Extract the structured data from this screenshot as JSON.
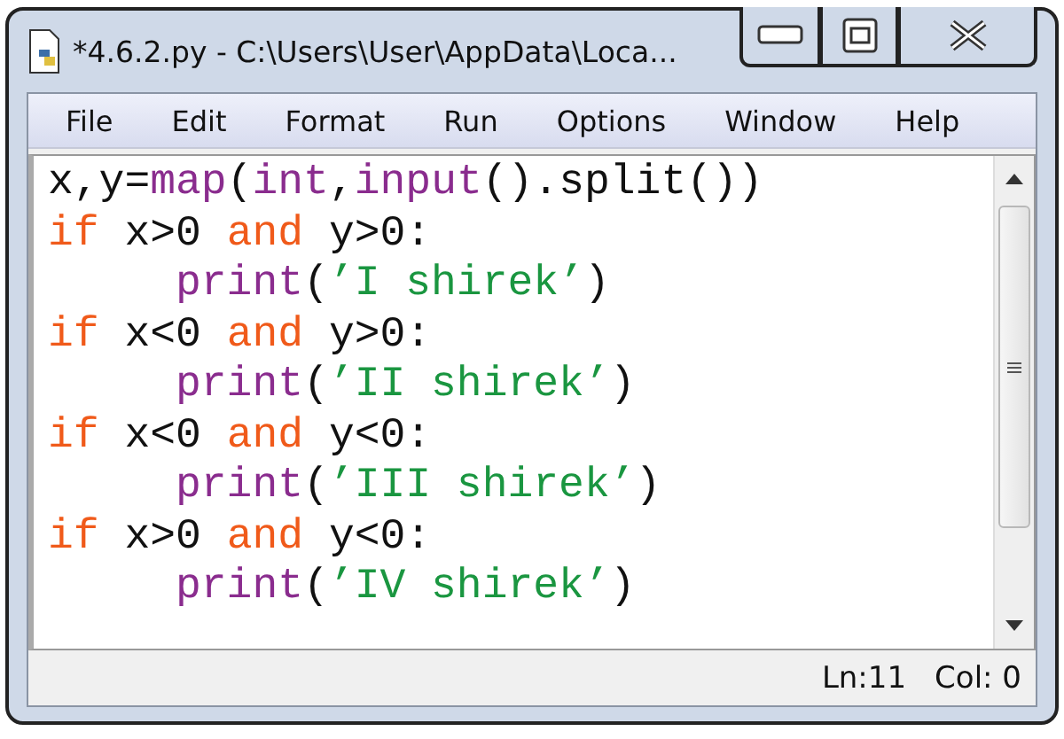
{
  "window": {
    "title": "*4.6.2.py - C:\\Users\\User\\AppData\\Loca..."
  },
  "menu": [
    "File",
    "Edit",
    "Format",
    "Run",
    "Options",
    "Window",
    "Help"
  ],
  "code": [
    {
      "tokens": [
        {
          "kind": "plain",
          "text": "x,y="
        },
        {
          "kind": "builtin",
          "text": "map"
        },
        {
          "kind": "plain",
          "text": "("
        },
        {
          "kind": "builtin",
          "text": "int"
        },
        {
          "kind": "plain",
          "text": ","
        },
        {
          "kind": "builtin",
          "text": "input"
        },
        {
          "kind": "plain",
          "text": "().split())"
        }
      ]
    },
    {
      "tokens": [
        {
          "kind": "keyword",
          "text": "if"
        },
        {
          "kind": "plain",
          "text": " x>0 "
        },
        {
          "kind": "keyword",
          "text": "and"
        },
        {
          "kind": "plain",
          "text": " y>0:"
        }
      ]
    },
    {
      "indented": true,
      "tokens": [
        {
          "kind": "builtin",
          "text": "print"
        },
        {
          "kind": "plain",
          "text": "("
        },
        {
          "kind": "string",
          "text": "’I shirek’"
        },
        {
          "kind": "plain",
          "text": ")"
        }
      ]
    },
    {
      "tokens": [
        {
          "kind": "keyword",
          "text": "if"
        },
        {
          "kind": "plain",
          "text": " x<0 "
        },
        {
          "kind": "keyword",
          "text": "and"
        },
        {
          "kind": "plain",
          "text": " y>0:"
        }
      ]
    },
    {
      "indented": true,
      "tokens": [
        {
          "kind": "builtin",
          "text": "print"
        },
        {
          "kind": "plain",
          "text": "("
        },
        {
          "kind": "string",
          "text": "’II shirek’"
        },
        {
          "kind": "plain",
          "text": ")"
        }
      ]
    },
    {
      "tokens": [
        {
          "kind": "keyword",
          "text": "if"
        },
        {
          "kind": "plain",
          "text": " x<0 "
        },
        {
          "kind": "keyword",
          "text": "and"
        },
        {
          "kind": "plain",
          "text": " y<0:"
        }
      ]
    },
    {
      "indented": true,
      "tokens": [
        {
          "kind": "builtin",
          "text": "print"
        },
        {
          "kind": "plain",
          "text": "("
        },
        {
          "kind": "string",
          "text": "’III shirek’"
        },
        {
          "kind": "plain",
          "text": ")"
        }
      ]
    },
    {
      "tokens": [
        {
          "kind": "keyword",
          "text": "if"
        },
        {
          "kind": "plain",
          "text": " x>0 "
        },
        {
          "kind": "keyword",
          "text": "and"
        },
        {
          "kind": "plain",
          "text": " y<0:"
        }
      ]
    },
    {
      "indented": true,
      "tokens": [
        {
          "kind": "builtin",
          "text": "print"
        },
        {
          "kind": "plain",
          "text": "("
        },
        {
          "kind": "string",
          "text": "’IV shirek’"
        },
        {
          "kind": "plain",
          "text": ")"
        }
      ]
    }
  ],
  "status_bar": {
    "line": "Ln:11",
    "column": "Col: 0"
  }
}
